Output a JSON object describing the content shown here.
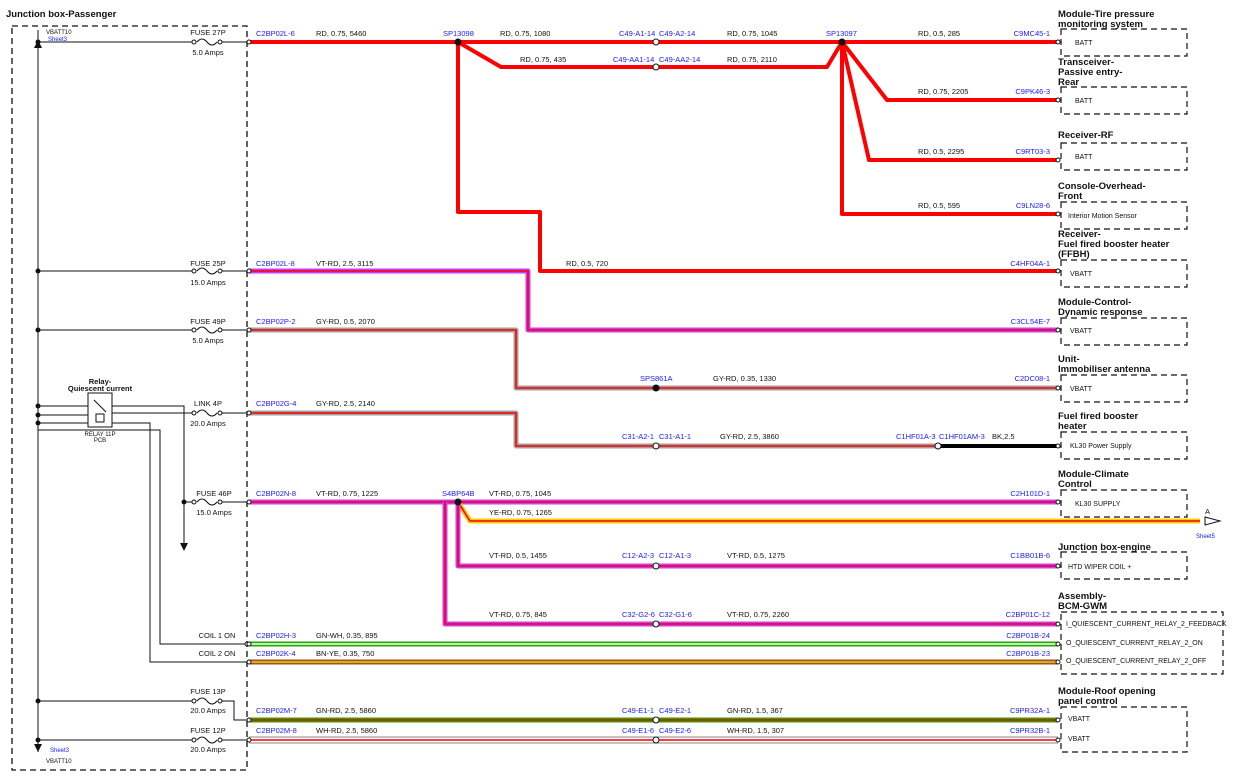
{
  "panel": {
    "title": "Junction box-Passenger",
    "vbatt_top": "VBATT10",
    "vbatt_top_ref": "Sheet3",
    "vbatt_bottom": "VBATT10",
    "vbatt_bottom_ref": "Sheet3"
  },
  "relay": {
    "title_line1": "Relay-",
    "title_line2": "Quiescent current",
    "sub1": "RELAY 11P",
    "sub2": "PCB"
  },
  "fuses": [
    {
      "name": "FUSE 27P",
      "rating": "5.0 Amps"
    },
    {
      "name": "FUSE 25P",
      "rating": "15.0 Amps"
    },
    {
      "name": "FUSE 49P",
      "rating": "5.0 Amps"
    },
    {
      "name": "LINK 4P",
      "rating": "20.0 Amps"
    },
    {
      "name": "FUSE 46P",
      "rating": "15.0 Amps"
    },
    {
      "name": "COIL 1 ON",
      "rating": ""
    },
    {
      "name": "COIL 2 ON",
      "rating": ""
    },
    {
      "name": "FUSE 13P",
      "rating": "20.0 Amps"
    },
    {
      "name": "FUSE 12P",
      "rating": "20.0 Amps"
    }
  ],
  "source_connectors": [
    "C2BP02L-6",
    "C2BP02L-8",
    "C2BP02P-2",
    "C2BP02G-4",
    "C2BP02N-8",
    "C2BP02H-3",
    "C2BP02K-4",
    "C2BP02M-7",
    "C2BP02M-8"
  ],
  "splices": [
    "SP13098",
    "SP13097",
    "SPS861A",
    "S4BP64B"
  ],
  "inline_connectors": {
    "c49_a1_14": "C49-A1-14",
    "c49_a2_14": "C49-A2-14",
    "c49_aa1_14": "C49-AA1-14",
    "c49_aa2_14": "C49-AA2-14",
    "c31_a2_1": "C31-A2-1",
    "c31_a1_1": "C31-A1-1",
    "c1hf01a_3": "C1HF01A-3",
    "c1hf01am_3": "C1HF01AM-3",
    "c12_a2_3": "C12-A2-3",
    "c12_a1_3": "C12-A1-3",
    "c32_g2_6": "C32-G2-6",
    "c32_g1_6": "C32-G1-6",
    "c49_e1_1": "C49-E1-1",
    "c49_e2_1": "C49-E2-1",
    "c49_e1_6": "C49-E1-6",
    "c49_e2_6": "C49-E2-6"
  },
  "wires": {
    "w1": "RD, 0.75, 5460",
    "w2": "RD, 0.75, 1080",
    "w3": "RD, 0.75, 1045",
    "w4": "RD, 0.75, 435",
    "w5": "RD, 0.75, 2110",
    "w6": "RD, 0.5, 285",
    "w7": "RD, 0.75, 2205",
    "w8": "RD, 0.5, 2295",
    "w9": "RD, 0.5, 595",
    "w10": "RD, 0.5, 720",
    "w11": "VT-RD, 2.5, 3115",
    "w12": "GY-RD, 0.5, 2070",
    "w13": "GY-RD, 0.35, 1330",
    "w14": "GY-RD, 2.5, 2140",
    "w15": "GY-RD, 2.5, 3860",
    "w16": "BK,2.5",
    "w17": "VT-RD, 0.75, 1225",
    "w18": "VT-RD, 0.75, 1045",
    "w19": "YE-RD, 0.75, 1265",
    "w20": "VT-RD, 0.5, 1455",
    "w21": "VT-RD, 0.5, 1275",
    "w22": "VT-RD, 0.75, 845",
    "w23": "VT-RD, 0.75, 2260",
    "w24": "GN-WH, 0.35, 895",
    "w25": "BN-YE, 0.35, 750",
    "w26": "GN-RD, 2.5, 5860",
    "w27": "GN-RD, 1.5, 367",
    "w28": "WH-RD, 2.5, 5860",
    "w29": "WH-RD, 1.5, 307"
  },
  "modules": [
    {
      "title1": "Module-Tire pressure",
      "title2": "monitoring system",
      "title3": "",
      "connector": "C9MC45-1",
      "pin": "BATT"
    },
    {
      "title1": "Transceiver-",
      "title2": "Passive entry-",
      "title3": "Rear",
      "connector": "C9PK46-3",
      "pin": "BATT"
    },
    {
      "title1": "Receiver-RF",
      "title2": "",
      "title3": "",
      "connector": "C9RT03-3",
      "pin": "BATT"
    },
    {
      "title1": "Console-Overhead-",
      "title2": "Front",
      "title3": "",
      "connector": "C9LN28-6",
      "pin": "Interior Motion Sensor"
    },
    {
      "title1": "Receiver-",
      "title2": "Fuel fired booster heater",
      "title3": "(FFBH)",
      "connector": "C4HF04A-1",
      "pin": "VBATT"
    },
    {
      "title1": "Module-Control-",
      "title2": "Dynamic response",
      "title3": "",
      "connector": "C3CL54E-7",
      "pin": "VBATT"
    },
    {
      "title1": "Unit-",
      "title2": "Immobiliser antenna",
      "title3": "",
      "connector": "C2DC08-1",
      "pin": "VBATT"
    },
    {
      "title1": "Fuel fired booster",
      "title2": "heater",
      "title3": "",
      "connector": "",
      "pin": "KL30 Power Supply"
    },
    {
      "title1": "Module-Climate",
      "title2": "Control",
      "title3": "",
      "connector": "C2H101D-1",
      "pin": "KL30 SUPPLY"
    },
    {
      "title1": "Junction box-engine",
      "title2": "",
      "title3": "",
      "connector": "C1BB01B-6",
      "pin": "HTD WIPER COIL +"
    },
    {
      "title1": "Assembly-",
      "title2": "BCM-GWM",
      "title3": "",
      "connector": "",
      "pin": ""
    },
    {
      "title1": "Module-Roof opening",
      "title2": "panel control",
      "title3": "",
      "connector": "",
      "pin": ""
    }
  ],
  "bcm": {
    "conn1": "C2BP01C-12",
    "pin1": "I_QUIESCENT_CURRENT_RELAY_2_FEEDBACK",
    "conn2": "C2BP01B-24",
    "pin2": "O_QUIESCENT_CURRENT_RELAY_2_ON",
    "conn3": "C2BP01B-23",
    "pin3": "O_QUIESCENT_CURRENT_RELAY_2_OFF"
  },
  "roof": {
    "conn1": "C9PR32A-1",
    "pin1": "VBATT",
    "conn2": "C9PR32B-1",
    "pin2": "VBATT"
  },
  "offsheet": {
    "letter": "A",
    "ref": "Sheet5"
  },
  "colors": {
    "red": "#ff0000",
    "violet": "#c040ff",
    "grey": "#a0a0a0",
    "green": "#22aa00",
    "yellow": "#f0d000",
    "brown": "#a0522d",
    "black": "#000000",
    "white": "#ffffff",
    "connector_text": "#1a1aff"
  }
}
